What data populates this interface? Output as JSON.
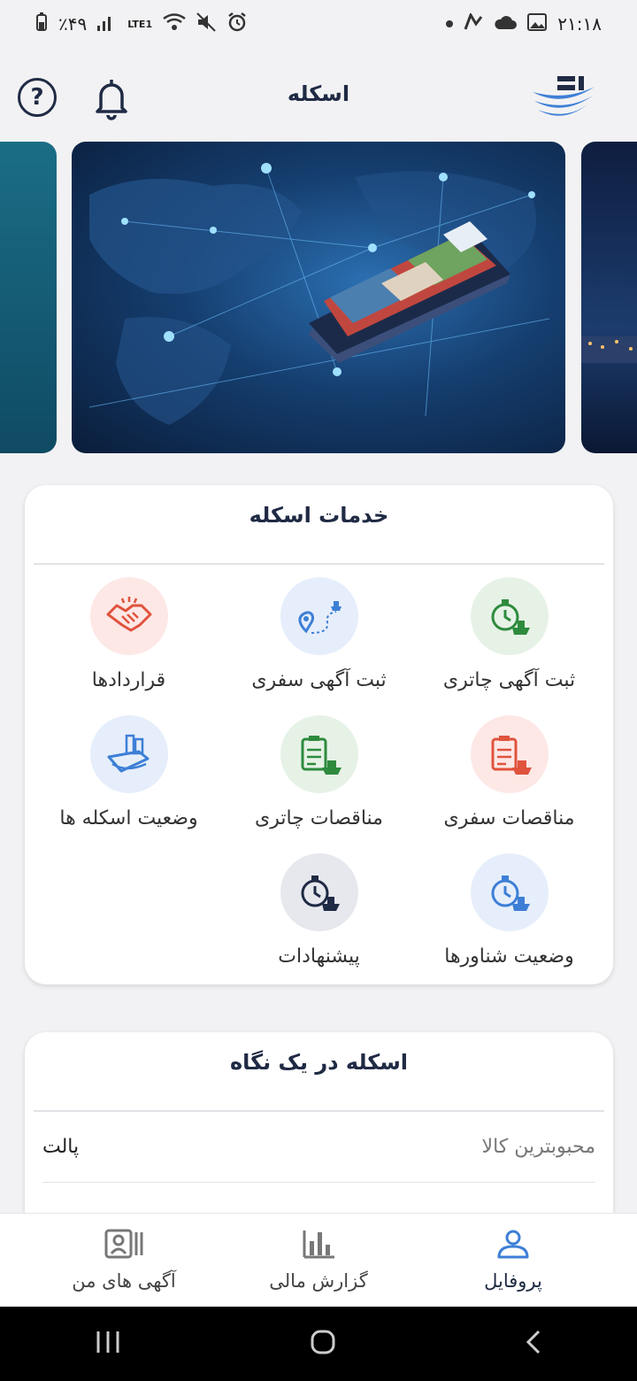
{
  "status_bar": {
    "time": "۲۱:۱۸",
    "battery": "٪۴۹",
    "network": "LTE1"
  },
  "header": {
    "title": "اسکله"
  },
  "services": {
    "title": "خدمات اسکله",
    "items": [
      {
        "label": "ثبت آگهی چاتری",
        "icon": "stopwatch-ship-icon"
      },
      {
        "label": "ثبت آگهی سفری",
        "icon": "route-pin-ship-icon"
      },
      {
        "label": "قراردادها",
        "icon": "handshake-icon"
      },
      {
        "label": "مناقصات سفری",
        "icon": "clipboard-ship-icon"
      },
      {
        "label": "مناقصات  چاتری",
        "icon": "clipboard-ship-icon"
      },
      {
        "label": "وضعیت اسکله ها",
        "icon": "port-ship-icon"
      },
      {
        "label": "وضعیت شناورها",
        "icon": "stopwatch-ship-icon"
      },
      {
        "label": "پیشنهادات",
        "icon": "stopwatch-ship-icon"
      }
    ]
  },
  "glance": {
    "title": "اسکله در یک نگاه",
    "rows": [
      {
        "key": "محبوبترین کالا",
        "value": "پالت"
      }
    ]
  },
  "bottom_nav": {
    "items": [
      {
        "label": "آگهی های من",
        "icon": "id-card-icon"
      },
      {
        "label": "گزارش مالی",
        "icon": "bar-chart-icon"
      },
      {
        "label": "پروفایل",
        "icon": "user-icon"
      }
    ]
  },
  "colors": {
    "primary": "#1f2a44",
    "accent_blue": "#3d7fd6",
    "green_bg": "#e6f2e6",
    "red_bg": "#fde8e6",
    "blue_bg": "#e6eefb",
    "grey_bg": "#e6e8ee"
  }
}
